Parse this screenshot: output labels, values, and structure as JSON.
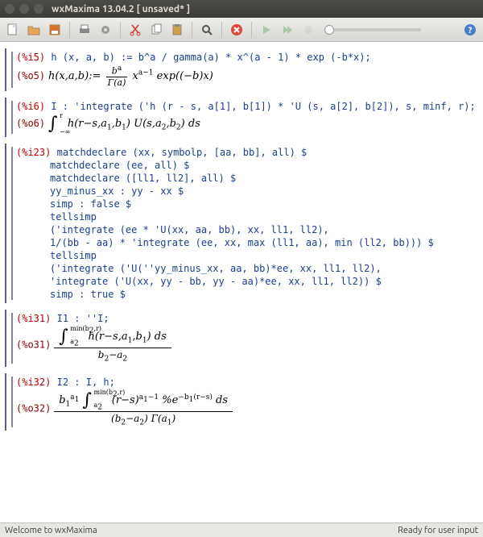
{
  "window": {
    "title": "wxMaxima 13.04.2 [ unsaved* ]"
  },
  "toolbar": {
    "icons": [
      "new-file",
      "open-file",
      "save-file",
      "print",
      "settings",
      "cut",
      "copy",
      "paste",
      "find",
      "stop",
      "play",
      "play-debug",
      "anim-start"
    ],
    "help_icon": "help"
  },
  "status": {
    "left": "Welcome to wxMaxima",
    "right": "Ready for user input"
  },
  "cells": [
    {
      "in_label": "(%i5)",
      "in_text": "h (x, a, b) := b^a / gamma(a) * x^(a - 1) * exp (-b*x);",
      "out_label": "(%o5)",
      "out_math": "h(x,a,b):=\\frac{b^a}{\\Gamma(a)} x^{a-1} \\exp((-b)x)"
    },
    {
      "in_label": "(%i6)",
      "in_text": "I : 'integrate ('h (r - s, a[1], b[1]) * 'U (s, a[2], b[2]), s, minf, r);",
      "out_label": "(%o6)",
      "out_math": "\\int_{-\\infty}^{r} h(r-s,a_1,b_1) U(s,a_2,b_2) ds"
    },
    {
      "in_label": "(%i23)",
      "lines": [
        "matchdeclare (xx, symbolp, [aa, bb], all) $",
        "matchdeclare (ee, all) $",
        "matchdeclare ([ll1, ll2], all) $",
        "yy_minus_xx : yy - xx $",
        "simp : false $",
        "tellsimp",
        "('integrate (ee * 'U(xx, aa, bb), xx, ll1, ll2),",
        "1/(bb - aa) * 'integrate (ee, xx, max (ll1, aa), min (ll2, bb))) $",
        "tellsimp",
        "('integrate ('U(''yy_minus_xx, aa, bb)*ee, xx, ll1, ll2),",
        "'integrate ('U(xx, yy - bb, yy - aa)*ee, xx, ll1, ll2)) $",
        "simp : true $"
      ]
    },
    {
      "in_label": "(%i31)",
      "in_text": "I1 : ''I;",
      "out_label": "(%o31)",
      "out_math": "\\frac{\\int_{a_2}^{\\min(b_2,r)} h(r-s,a_1,b_1) ds}{b_2 - a_2}"
    },
    {
      "in_label": "(%i32)",
      "in_text": "I2 : I, h;",
      "out_label": "(%o32)",
      "out_math": "\\frac{ b_1^{a_1} \\int_{a_2}^{\\min(b_2,r)} (r-s)^{a_1-1} \\%e^{-b_1(r-s)} ds }{ (b_2 - a_2) \\Gamma(a_1) }"
    }
  ]
}
